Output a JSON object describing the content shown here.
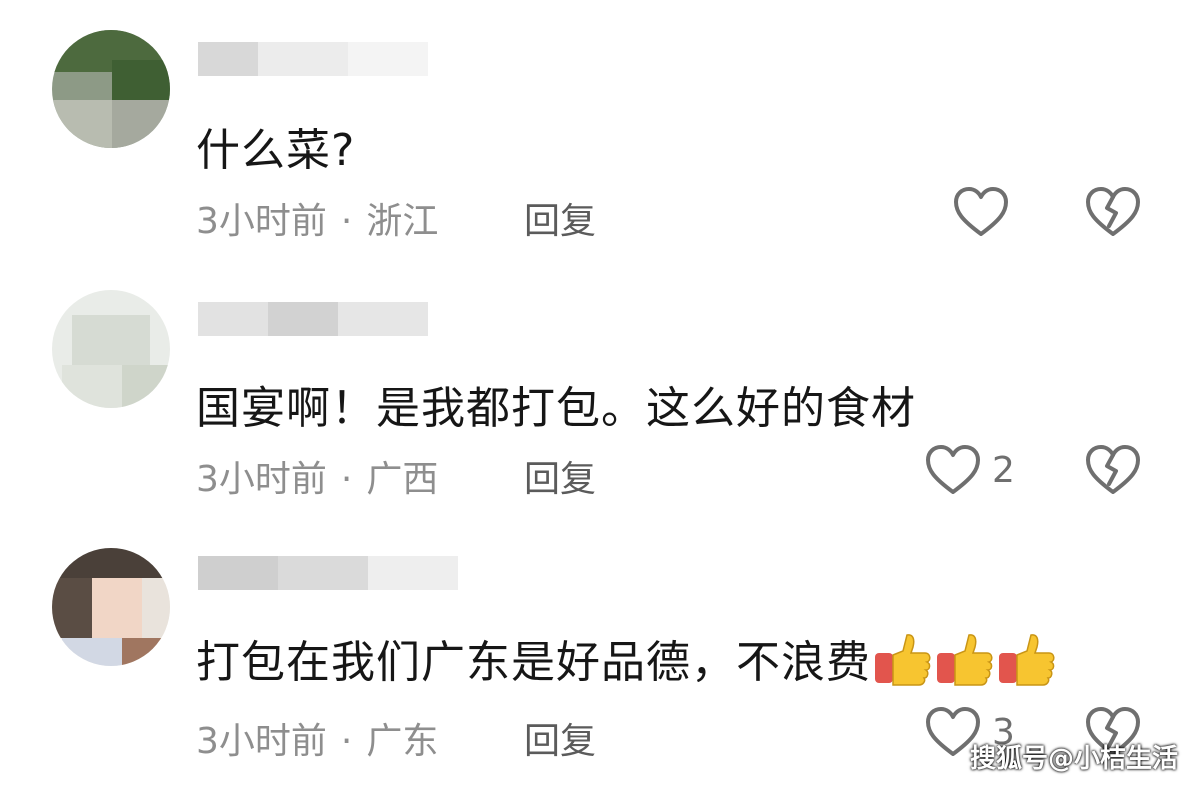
{
  "comments": [
    {
      "text": "什么菜?",
      "time": "3小时前",
      "separator": "·",
      "location": "浙江",
      "reply_label": "回复",
      "like_count": ""
    },
    {
      "text": "国宴啊！是我都打包。这么好的食材",
      "time": "3小时前",
      "separator": "·",
      "location": "广西",
      "reply_label": "回复",
      "like_count": "2"
    },
    {
      "text": "打包在我们广东是好品德，不浪费",
      "time": "3小时前",
      "separator": "·",
      "location": "广东",
      "reply_label": "回复",
      "like_count": "3",
      "emoji": [
        "thumbs-up-emoji",
        "thumbs-up-emoji",
        "thumbs-up-emoji"
      ]
    }
  ],
  "watermark": "搜狐号@小桔生活",
  "colors": {
    "text": "#161616",
    "meta": "#8e8e8e",
    "icon": "#6f6f6f",
    "emoji_thumb": "#f7c530",
    "emoji_cuff": "#e2554d"
  },
  "icons": {
    "like": "heart-outline-icon",
    "dislike": "broken-heart-icon"
  }
}
